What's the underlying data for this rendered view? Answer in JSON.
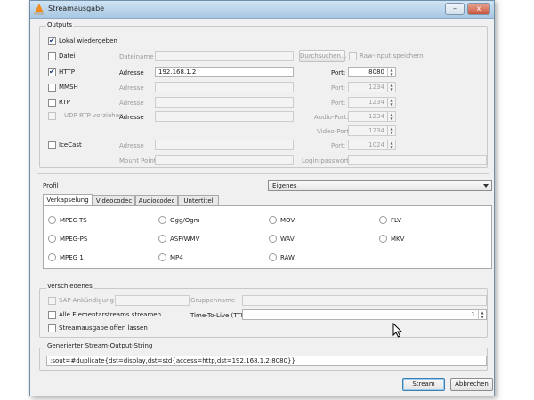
{
  "window": {
    "title": "Streamausgabe",
    "controls": [
      "–",
      "x"
    ]
  },
  "outputs": {
    "legend": "Outputs",
    "local_label": "Lokal wiedergeben",
    "file": {
      "label": "Datei",
      "name_label": "Dateiname",
      "browse_label": "Durchsuchen...",
      "raw_label": "Raw-Input speichern"
    },
    "http": {
      "label": "HTTP",
      "address_label": "Adresse",
      "address_value": "192.168.1.2",
      "port_label": "Port:",
      "port_value": "8080"
    },
    "mmsh": {
      "label": "MMSH",
      "address_label": "Adresse",
      "port_label": "Port:",
      "port_value": "1234"
    },
    "rtp": {
      "label": "RTP",
      "address_label": "Adresse",
      "port_label": "Port:",
      "port_value": "1234"
    },
    "udp": {
      "label": "UDP RTP vorziehen",
      "address_label": "Adresse",
      "audio_port_label": "Audio-Port:",
      "audio_port_value": "1234",
      "video_port_label": "Video-Port",
      "video_port_value": "1234"
    },
    "icecast": {
      "label": "IceCast",
      "address_label": "Adresse",
      "port_label": "Port:",
      "port_value": "1024",
      "mount_label": "Mount Point",
      "login_label": "Login:passwort:"
    }
  },
  "profile": {
    "label": "Profil",
    "selected": "Eigenes",
    "tabs": [
      "Verkapselung",
      "Videocodec",
      "Audiocodec",
      "Untertitel"
    ],
    "formats": [
      "MPEG-TS",
      "Ogg/Ogm",
      "MOV",
      "FLV",
      "MPEG-PS",
      "ASF/WMV",
      "WAV",
      "MKV",
      "MPEG 1",
      "MP4",
      "RAW"
    ]
  },
  "misc": {
    "legend": "Verschiedenes",
    "sap_label": "SAP-Ankündigung",
    "group_label": "Gruppenname",
    "all_es_label": "Alle Elementarstreams streamen",
    "ttl_label": "Time-To-Live (TTL)",
    "ttl_value": "1",
    "keep_open_label": "Streamausgabe offen lassen"
  },
  "output_string": {
    "legend": "Generierter Stream-Output-String",
    "value": ":sout=#duplicate{dst=display,dst=std{access=http,dst=192.168.1.2:8080}}"
  },
  "buttons": {
    "stream": "Stream",
    "cancel": "Abbrechen"
  },
  "colors": {
    "accent": "#f08a1a",
    "titlebar": "#a9c8e3",
    "checkmark": "#1d3e7a"
  }
}
